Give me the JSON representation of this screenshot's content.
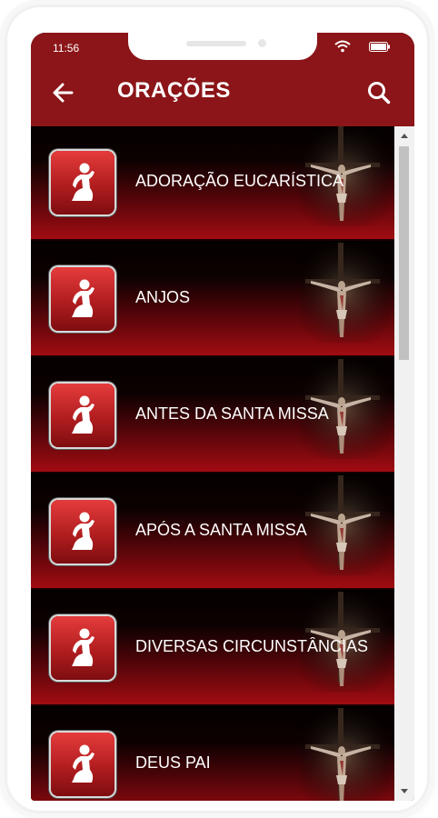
{
  "status_bar": {
    "time": "11:56"
  },
  "header": {
    "title": "ORAÇÕES",
    "back_icon": "arrow-left-icon",
    "search_icon": "search-icon"
  },
  "colors": {
    "header_bg": "#8b1518",
    "item_gradient_bottom": "#a10c12",
    "icon_red": "#b11d1f"
  },
  "prayers": [
    {
      "label": "ADORAÇÃO EUCARÍSTICA"
    },
    {
      "label": "ANJOS"
    },
    {
      "label": "ANTES DA SANTA MISSA"
    },
    {
      "label": "APÓS A SANTA MISSA"
    },
    {
      "label": "DIVERSAS CIRCUNSTÂNCIAS"
    },
    {
      "label": "DEUS PAI"
    }
  ],
  "scroll": {
    "position_fraction": 0.0,
    "visible_fraction": 0.32
  }
}
